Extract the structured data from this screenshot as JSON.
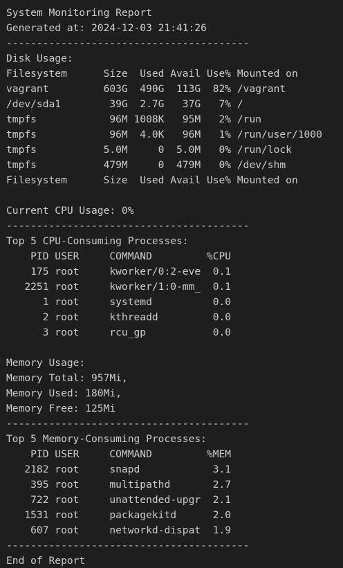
{
  "terminal": {
    "lines": [
      "System Monitoring Report",
      "Generated at: 2024-12-03 21:41:26",
      "----------------------------------------",
      "Disk Usage:",
      "Filesystem      Size  Used Avail Use% Mounted on",
      "vagrant         603G  490G  113G  82% /vagrant",
      "/dev/sda1        39G  2.7G   37G   7% /",
      "tmpfs            96M 1008K   95M   2% /run",
      "tmpfs            96M  4.0K   96M   1% /run/user/1000",
      "tmpfs           5.0M     0  5.0M   0% /run/lock",
      "tmpfs           479M     0  479M   0% /dev/shm",
      "Filesystem      Size  Used Avail Use% Mounted on",
      "",
      "Current CPU Usage: 0%",
      "----------------------------------------",
      "Top 5 CPU-Consuming Processes:",
      "    PID USER     COMMAND         %CPU",
      "    175 root     kworker/0:2-eve  0.1",
      "   2251 root     kworker/1:0-mm_  0.1",
      "      1 root     systemd          0.0",
      "      2 root     kthreadd         0.0",
      "      3 root     rcu_gp           0.0",
      "",
      "Memory Usage:",
      "Memory Total: 957Mi,",
      "Memory Used: 180Mi,",
      "Memory Free: 125Mi",
      "----------------------------------------",
      "Top 5 Memory-Consuming Processes:",
      "    PID USER     COMMAND         %MEM",
      "   2182 root     snapd            3.1",
      "    395 root     multipathd       2.7",
      "    722 root     unattended-upgr  2.1",
      "   1531 root     packagekitd      2.0",
      "    607 root     networkd-dispat  1.9",
      "----------------------------------------",
      "End of Report"
    ]
  },
  "colors": {
    "background": "#1e1e1e",
    "foreground": "#cccccc"
  }
}
